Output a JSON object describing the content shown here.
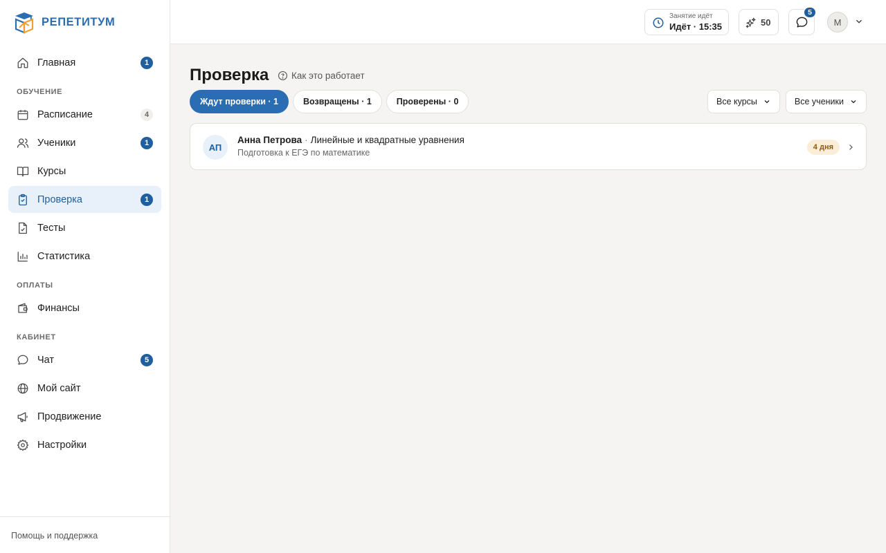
{
  "brand": {
    "name": "РЕПЕТИТУМ"
  },
  "sidebar": {
    "items": [
      {
        "label": "Главная",
        "badge": "1"
      },
      {
        "section": "ОБУЧЕНИЕ"
      },
      {
        "label": "Расписание",
        "badge": "4"
      },
      {
        "label": "Ученики",
        "badge": "1"
      },
      {
        "label": "Курсы"
      },
      {
        "label": "Проверка",
        "badge": "1",
        "active": true
      },
      {
        "label": "Тесты"
      },
      {
        "label": "Статистика"
      },
      {
        "section": "ОПЛАТЫ"
      },
      {
        "label": "Финансы"
      },
      {
        "section": "КАБИНЕТ"
      },
      {
        "label": "Чат",
        "badge": "5"
      },
      {
        "label": "Мой сайт"
      },
      {
        "label": "Продвижение"
      },
      {
        "label": "Настройки"
      }
    ],
    "footer": "Помощь и поддержка"
  },
  "header": {
    "lesson_small": "Занятие идёт",
    "lesson_big": "Идёт · 15:35",
    "points": "50",
    "chat_badge": "5",
    "avatar_letter": "М"
  },
  "main": {
    "title": "Проверка",
    "howto": "Как это работает",
    "tabs": [
      {
        "label": "Ждут проверки · 1",
        "active": true
      },
      {
        "label": "Возвращены · 1"
      },
      {
        "label": "Проверены · 0"
      }
    ],
    "filters": [
      {
        "label": "Все курсы"
      },
      {
        "label": "Все ученики"
      }
    ],
    "submissions": [
      {
        "initials": "АП",
        "student": "Анна Петрова",
        "separator": "·",
        "topic": "Линейные и квадратные уравнения",
        "course": "Подготовка к ЕГЭ по математике",
        "age": "4 дня"
      }
    ]
  },
  "colors": {
    "accent": "#2a6db3",
    "active_bg": "#e8f0f9",
    "pending_badge_bg": "#fbeed8",
    "page_bg": "#f5f4f2"
  }
}
